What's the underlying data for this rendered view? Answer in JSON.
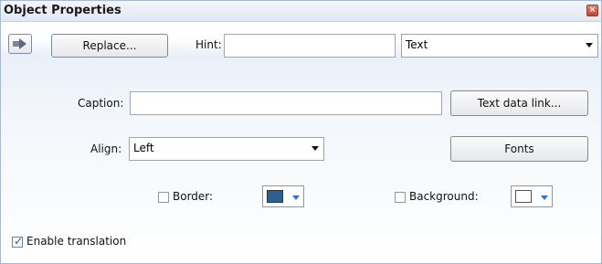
{
  "window": {
    "title": "Object Properties",
    "close_icon": "close-icon"
  },
  "toolbar": {
    "arrow_icon": "arrow-right-icon",
    "replace_label": "Replace...",
    "hint_label": "Hint:",
    "hint_value": "",
    "type_value": "Text"
  },
  "form": {
    "caption_label": "Caption:",
    "caption_value": "",
    "text_data_link_label": "Text data link...",
    "align_label": "Align:",
    "align_value": "Left",
    "fonts_label": "Fonts",
    "border_label": "Border:",
    "border_checked": false,
    "border_color": "#2f5f8f",
    "background_label": "Background:",
    "background_checked": false,
    "background_color": "#ffffff",
    "enable_translation_label": "Enable translation",
    "enable_translation_checked": true
  }
}
